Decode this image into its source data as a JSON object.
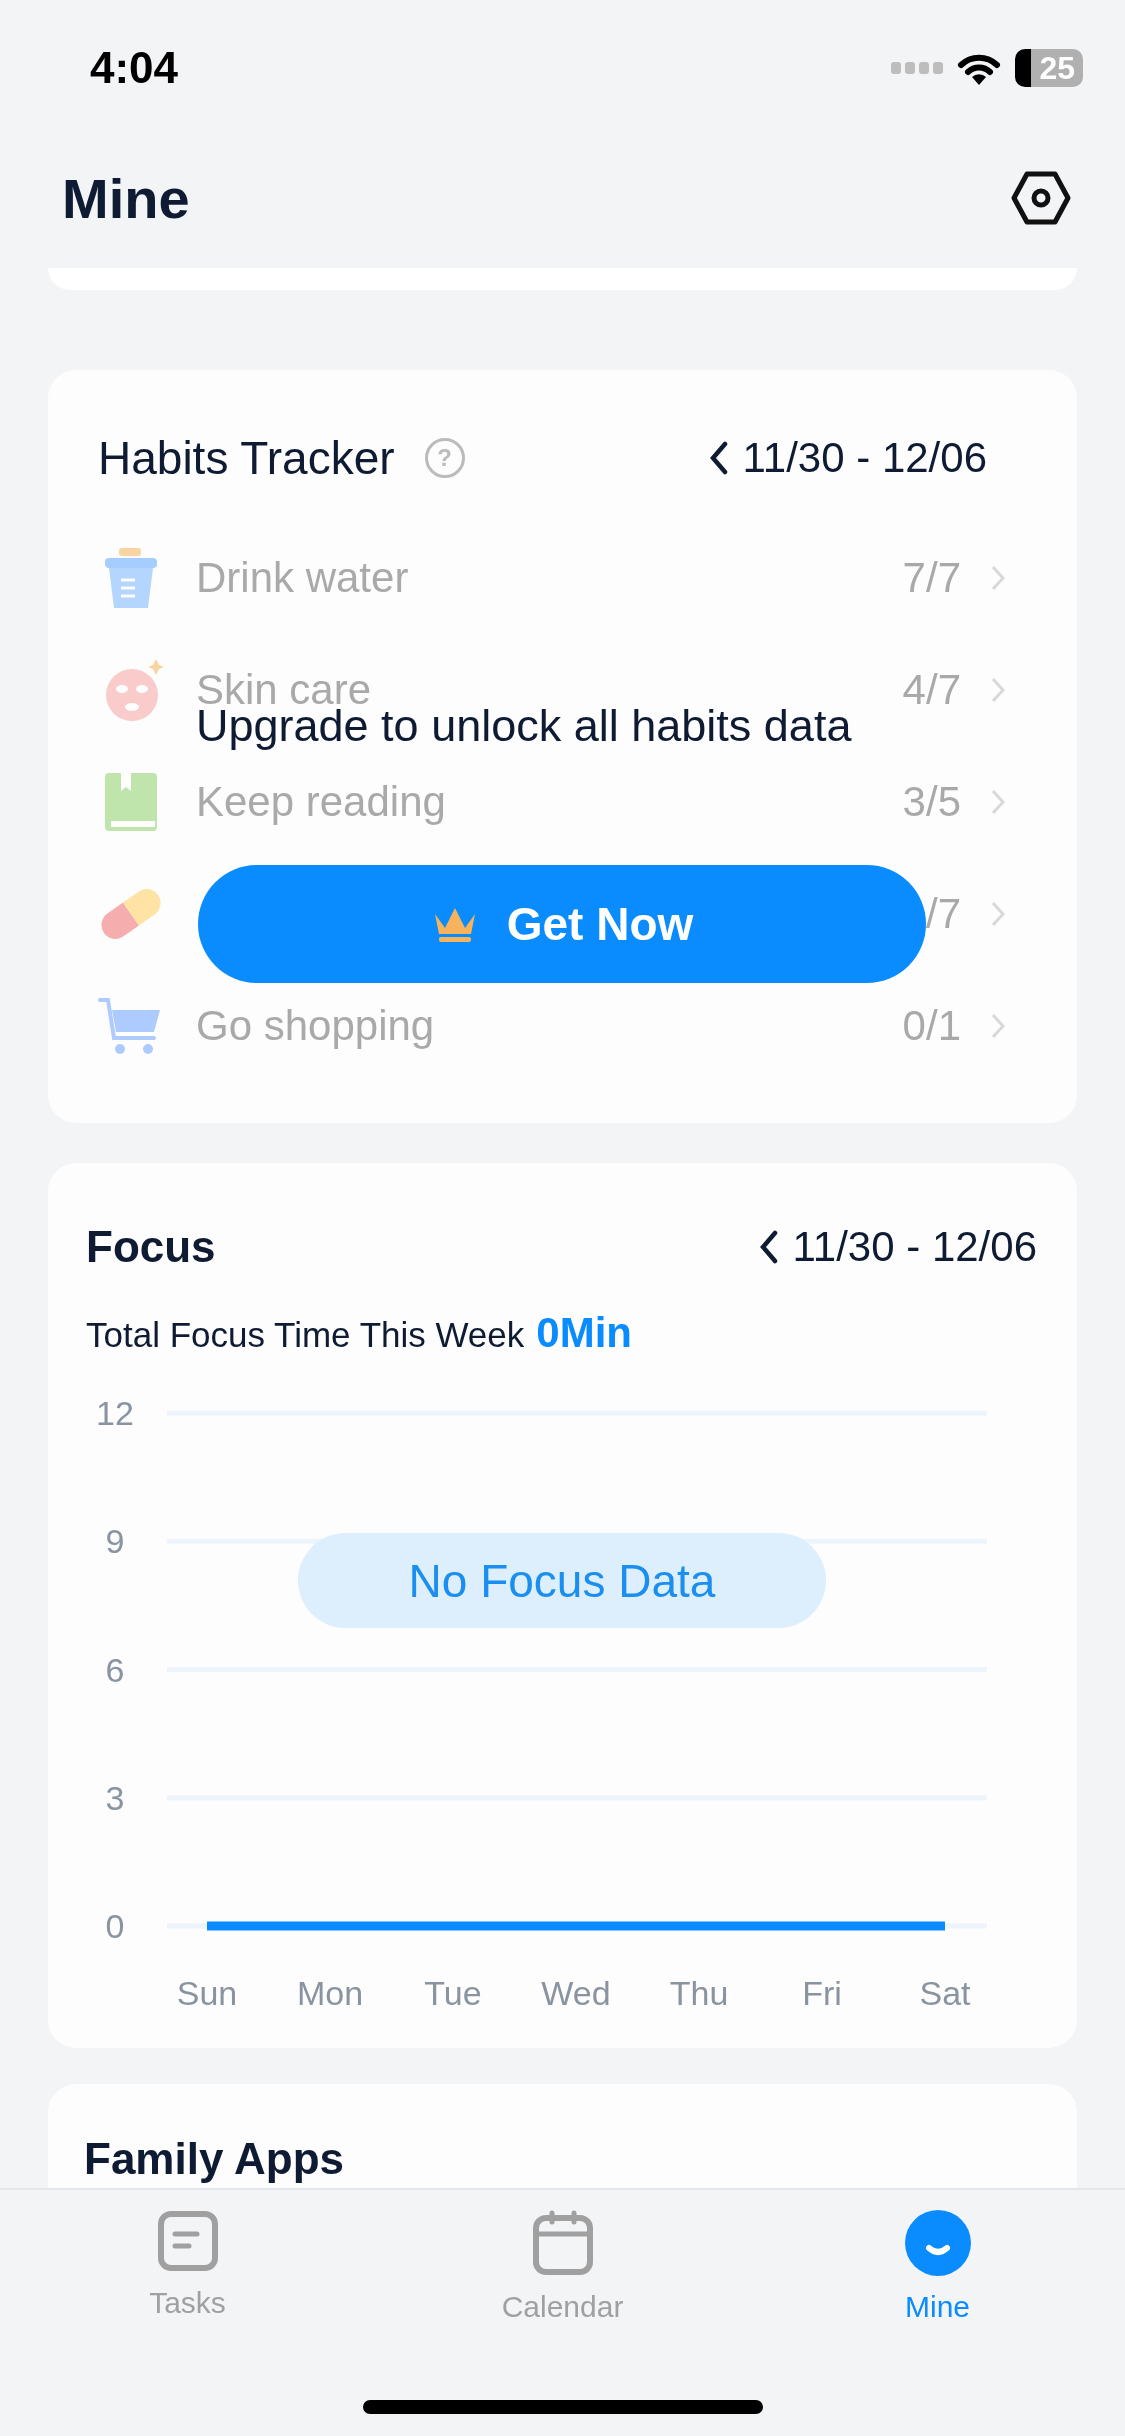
{
  "status_bar": {
    "time": "4:04",
    "battery": "25"
  },
  "header": {
    "title": "Mine"
  },
  "habits": {
    "title": "Habits Tracker",
    "help": "?",
    "range": "11/30 - 12/06",
    "locked": true,
    "upgrade_message": "Upgrade to unlock all habits data",
    "upgrade_button": "Get Now",
    "items": [
      {
        "kind": "cup",
        "name": "Drink water",
        "count": "7/7"
      },
      {
        "kind": "mask",
        "name": "Skin care",
        "count": "4/7"
      },
      {
        "kind": "book",
        "name": "Keep reading",
        "count": "3/5"
      },
      {
        "kind": "pill",
        "count": "/7"
      },
      {
        "kind": "cart",
        "name": "Go shopping",
        "count": "0/1"
      }
    ]
  },
  "focus": {
    "title": "Focus",
    "range": "11/30 - 12/06",
    "total_label": "Total Focus Time This Week",
    "total_value": "0Min",
    "empty_message": "No Focus Data",
    "chart_data": {
      "type": "line",
      "categories": [
        "Sun",
        "Mon",
        "Tue",
        "Wed",
        "Thu",
        "Fri",
        "Sat"
      ],
      "ylim": [
        0,
        12
      ],
      "yticks": [
        0,
        3,
        6,
        9,
        12
      ],
      "grid": true,
      "series": [
        {
          "color": "#0a8cff",
          "values": [
            0,
            0,
            0,
            0,
            0,
            0,
            0
          ]
        }
      ]
    }
  },
  "family_apps": {
    "title": "Family Apps"
  },
  "tabs": [
    {
      "kind": "tasks",
      "label": "Tasks",
      "selected": false
    },
    {
      "kind": "calendar",
      "label": "Calendar",
      "selected": false
    },
    {
      "kind": "mine",
      "label": "Mine",
      "selected": true
    }
  ]
}
